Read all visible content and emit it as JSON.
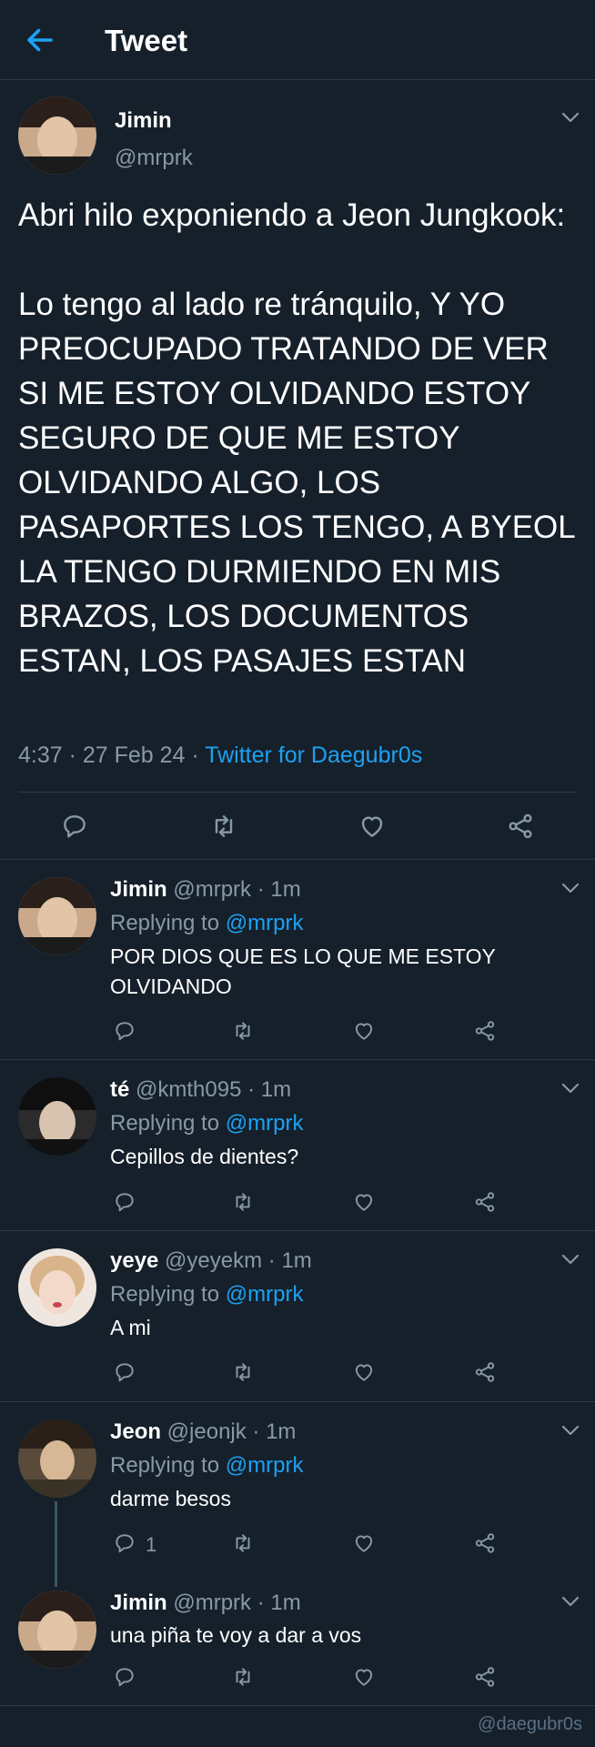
{
  "header": {
    "title": "Tweet",
    "back_icon": "arrow-left-icon"
  },
  "main_tweet": {
    "name": "Jimin",
    "handle": "@mrprk",
    "text": "Abri hilo exponiendo a Jeon Jungkook:\n\nLo tengo al lado re tránquilo, Y YO PREOCUPADO TRATANDO DE VER SI ME ESTOY OLVIDANDO ESTOY SEGURO DE QUE ME ESTOY OLVIDANDO ALGO, LOS PASAPORTES LOS TENGO, A BYEOL LA TENGO DURMIENDO EN MIS BRAZOS, LOS DOCUMENTOS ESTAN, LOS PASAJES ESTAN",
    "timestamp": "4:37 · 27 Feb 24 · ",
    "source": "Twitter for Daegubr0s"
  },
  "replying_label": "Replying to ",
  "replies": [
    {
      "name": "Jimin",
      "meta": " @mrprk · 1m",
      "replying_to": "@mrprk",
      "text": "POR DIOS QUE ES LO QUE ME ESTOY OLVIDANDO",
      "reply_count": ""
    },
    {
      "name": "té",
      "meta": " @kmth095 · 1m",
      "replying_to": "@mrprk",
      "text": "Cepillos de dientes?",
      "reply_count": ""
    },
    {
      "name": "yeye",
      "meta": " @yeyekm · 1m",
      "replying_to": "@mrprk",
      "text": "A mi",
      "reply_count": ""
    },
    {
      "name": "Jeon",
      "meta": " @jeonjk · 1m",
      "replying_to": "@mrprk",
      "text": "darme besos",
      "reply_count": "1"
    },
    {
      "name": "Jimin",
      "meta": " @mrprk · 1m",
      "replying_to": "",
      "text": "una piña te voy a dar a vos",
      "reply_count": ""
    }
  ],
  "watermark": "@daegubr0s",
  "colors": {
    "background": "#15202b",
    "accent": "#1da1f2",
    "muted": "#8899a6",
    "divider": "#2f3b47"
  }
}
